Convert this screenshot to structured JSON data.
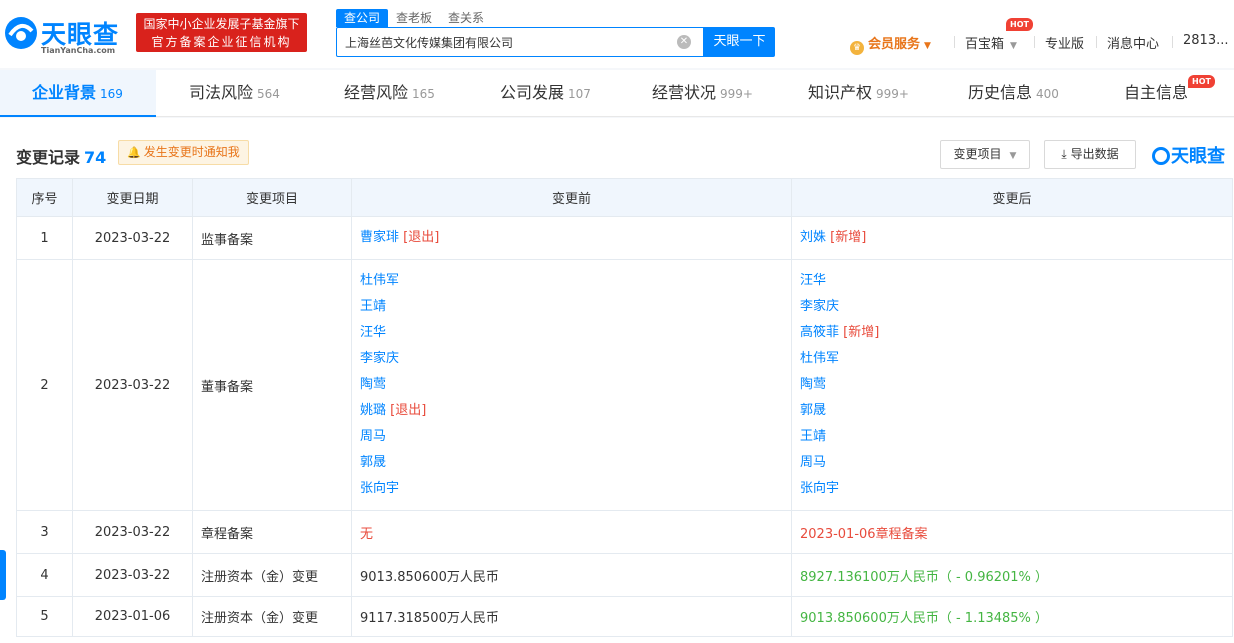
{
  "header": {
    "logo_text": "天眼查",
    "logo_sub": "TianYanCha.com",
    "gov_line1": "国家中小企业发展子基金旗下",
    "gov_line2": "官方备案企业征信机构",
    "search_tabs": [
      "查公司",
      "查老板",
      "查关系"
    ],
    "search_value": "上海丝芭文化传媒集团有限公司",
    "search_button": "天眼一下",
    "vip_label": "会员服务",
    "baibao_label": "百宝箱",
    "hot_label": "HOT",
    "pro_label": "专业版",
    "message_label": "消息中心",
    "user_label": "2813..."
  },
  "tabs": [
    {
      "label": "企业背景",
      "count": "169"
    },
    {
      "label": "司法风险",
      "count": "564"
    },
    {
      "label": "经营风险",
      "count": "165"
    },
    {
      "label": "公司发展",
      "count": "107"
    },
    {
      "label": "经营状况",
      "count": "999+"
    },
    {
      "label": "知识产权",
      "count": "999+"
    },
    {
      "label": "历史信息",
      "count": "400"
    },
    {
      "label": "自主信息",
      "count": ""
    }
  ],
  "section": {
    "title": "变更记录",
    "count": "74",
    "notify_label": "发生变更时通知我",
    "filter_label": "变更项目",
    "export_label": "导出数据",
    "logo_label": "天眼查"
  },
  "table": {
    "headers": [
      "序号",
      "变更日期",
      "变更项目",
      "变更前",
      "变更后"
    ],
    "rows": [
      {
        "no": "1",
        "date": "2023-03-22",
        "item": "监事备案",
        "before": [
          {
            "name": "曹家琲",
            "tag": "[退出]"
          }
        ],
        "after": [
          {
            "name": "刘姝",
            "tag": "[新增]"
          }
        ]
      },
      {
        "no": "2",
        "date": "2023-03-22",
        "item": "董事备案",
        "before": [
          {
            "name": "杜伟军",
            "tag": ""
          },
          {
            "name": "王靖",
            "tag": ""
          },
          {
            "name": "汪华",
            "tag": ""
          },
          {
            "name": "李家庆",
            "tag": ""
          },
          {
            "name": "陶莺",
            "tag": ""
          },
          {
            "name": "姚璐",
            "tag": "[退出]"
          },
          {
            "name": "周马",
            "tag": ""
          },
          {
            "name": "郭晟",
            "tag": ""
          },
          {
            "name": "张向宇",
            "tag": ""
          }
        ],
        "after": [
          {
            "name": "汪华",
            "tag": ""
          },
          {
            "name": "李家庆",
            "tag": ""
          },
          {
            "name": "高筱菲",
            "tag": "[新增]"
          },
          {
            "name": "杜伟军",
            "tag": ""
          },
          {
            "name": "陶莺",
            "tag": ""
          },
          {
            "name": "郭晟",
            "tag": ""
          },
          {
            "name": "王靖",
            "tag": ""
          },
          {
            "name": "周马",
            "tag": ""
          },
          {
            "name": "张向宇",
            "tag": ""
          }
        ]
      },
      {
        "no": "3",
        "date": "2023-03-22",
        "item": "章程备案",
        "before_text": "无",
        "after_text": "2023-01-06章程备案"
      },
      {
        "no": "4",
        "date": "2023-03-22",
        "item": "注册资本（金）变更",
        "before_text": "9013.850600万人民币",
        "after_text": "8927.136100万人民币（ - 0.96201% ）"
      },
      {
        "no": "5",
        "date": "2023-01-06",
        "item": "注册资本（金）变更",
        "before_text": "9117.318500万人民币",
        "after_text": "9013.850600万人民币（ - 1.13485% ）"
      }
    ]
  },
  "colors": {
    "brand": "#0084ff",
    "gov_red": "#d9221c",
    "tag_red": "#e84b3c",
    "green": "#44b542",
    "vip_orange": "#e8751a"
  }
}
